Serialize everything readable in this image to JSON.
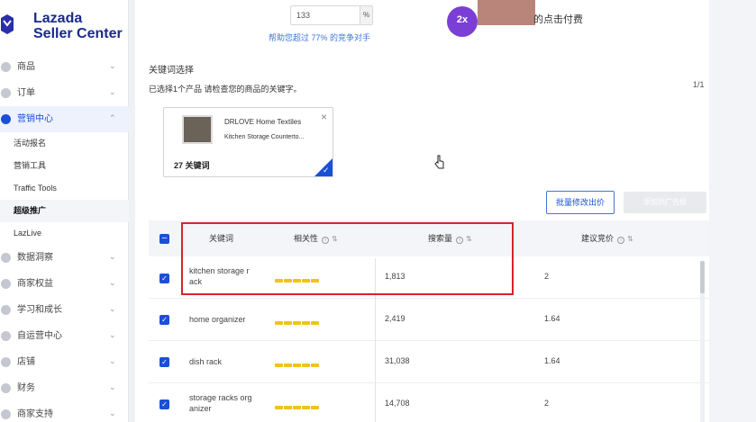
{
  "brand": {
    "line1": "Lazada",
    "line2": "Seller Center"
  },
  "sidebar": {
    "items": [
      {
        "label": "商品"
      },
      {
        "label": "订单"
      },
      {
        "label": "营销中心"
      },
      {
        "label": "数据洞察"
      },
      {
        "label": "商家权益"
      },
      {
        "label": "学习和成长"
      },
      {
        "label": "自运营中心"
      },
      {
        "label": "店铺"
      },
      {
        "label": "财务"
      },
      {
        "label": "商家支持"
      }
    ],
    "sub_items": [
      {
        "label": "活动报名"
      },
      {
        "label": "营销工具"
      },
      {
        "label": "Traffic Tools"
      },
      {
        "label": "超级推广"
      },
      {
        "label": "LazLive"
      }
    ]
  },
  "top": {
    "bid_value": "133",
    "bid_unit": "%",
    "help_text": "帮助您超过 77% 的竞争对手",
    "promo_badge": "2x",
    "promo_text": "的点击付费"
  },
  "keyword_section": {
    "title": "关键词选择",
    "selected_info": "已选择1个产品    请检查您的商品的关键字。",
    "pager": "1/1",
    "product": {
      "name": "DRLOVE Home Textiles",
      "subtitle": "Kitchen Storage Counterto...",
      "keyword_count": "27 关键词"
    },
    "bulk_button": "批量修改出价",
    "disabled_button": "添加到广告组"
  },
  "table": {
    "headers": {
      "keyword": "关键词",
      "relevance": "相关性",
      "volume": "搜索量",
      "bid": "建议竞价"
    },
    "rows": [
      {
        "keyword": "kitchen storage r ack",
        "volume": "1,813",
        "bid": "2"
      },
      {
        "keyword": "home organizer",
        "volume": "2,419",
        "bid": "1.64"
      },
      {
        "keyword": "dish rack",
        "volume": "31,038",
        "bid": "1.64"
      },
      {
        "keyword": "storage racks org anizer",
        "volume": "14,708",
        "bid": "2"
      }
    ]
  },
  "colors": {
    "accent": "#1a4fd6",
    "highlight": "#d6242c",
    "relevance": "#f2c21b"
  }
}
